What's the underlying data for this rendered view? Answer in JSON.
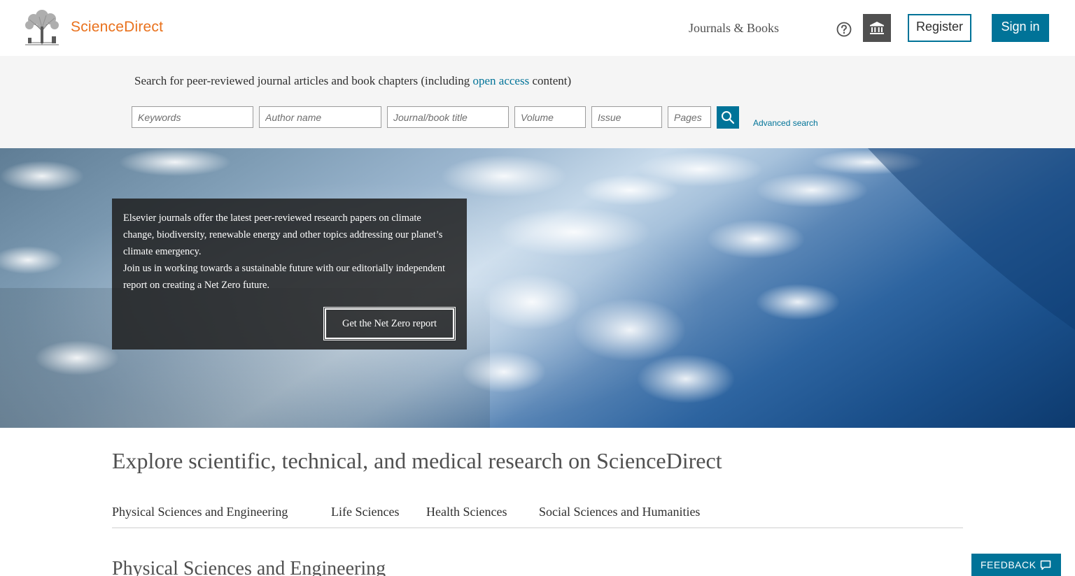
{
  "header": {
    "brand": "ScienceDirect",
    "logo_icon": "elsevier-tree-logo",
    "nav_journals": "Journals & Books",
    "help_icon": "help-circle-icon",
    "institution_icon": "institution-icon",
    "register_label": "Register",
    "signin_label": "Sign in"
  },
  "search": {
    "intro_before": "Search for peer-reviewed journal articles and book chapters (including ",
    "intro_link": "open access",
    "intro_after": " content)",
    "keywords_placeholder": "Keywords",
    "author_placeholder": "Author name",
    "journal_placeholder": "Journal/book title",
    "volume_placeholder": "Volume",
    "issue_placeholder": "Issue",
    "pages_placeholder": "Pages",
    "submit_icon": "search-icon",
    "advanced_label": "Advanced search"
  },
  "hero": {
    "text_line1": "Elsevier journals offer the latest peer-reviewed research papers on climate change, biodiversity, renewable energy and other topics addressing our planet’s climate emergency.",
    "text_line2": "Join us in working towards a sustainable future with our editorially independent report on creating a Net Zero future.",
    "cta_label": "Get the Net Zero report"
  },
  "explore": {
    "title": "Explore scientific, technical, and medical research on ScienceDirect",
    "tabs": [
      {
        "label": "Physical Sciences and Engineering"
      },
      {
        "label": "Life Sciences"
      },
      {
        "label": "Health Sciences"
      },
      {
        "label": "Social Sciences and Humanities"
      }
    ],
    "section_title": "Physical Sciences and Engineering"
  },
  "feedback": {
    "label": "FEEDBACK",
    "icon": "speech-bubble-icon"
  },
  "colors": {
    "brand_orange": "#e9711c",
    "accent_blue": "#007398",
    "dark_gray": "#505050"
  }
}
